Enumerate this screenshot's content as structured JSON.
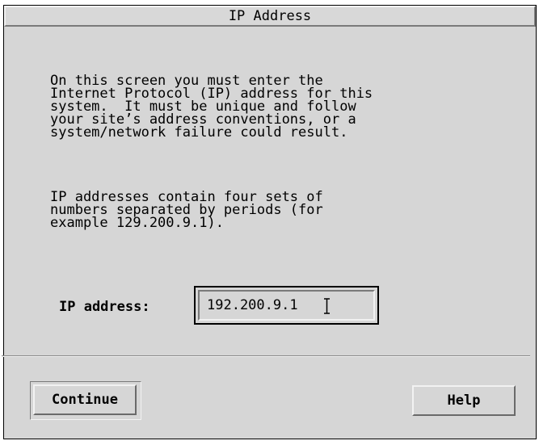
{
  "dialog": {
    "title": "IP Address",
    "description": "On this screen you must enter the\nInternet Protocol (IP) address for this\nsystem.  It must be unique and follow\nyour site’s address conventions, or a\nsystem/network failure could result.",
    "example_text": "IP addresses contain four sets of\nnumbers separated by periods (for\nexample 129.200.9.1).",
    "ip_field": {
      "label": "IP address:",
      "value": "192.200.9.1"
    },
    "buttons": {
      "continue_label": "Continue",
      "help_label": "Help"
    }
  },
  "icons": {
    "text_cursor": "i-beam-cursor-icon"
  },
  "colors": {
    "window_background": "#d6d6d6",
    "text": "#000000"
  }
}
